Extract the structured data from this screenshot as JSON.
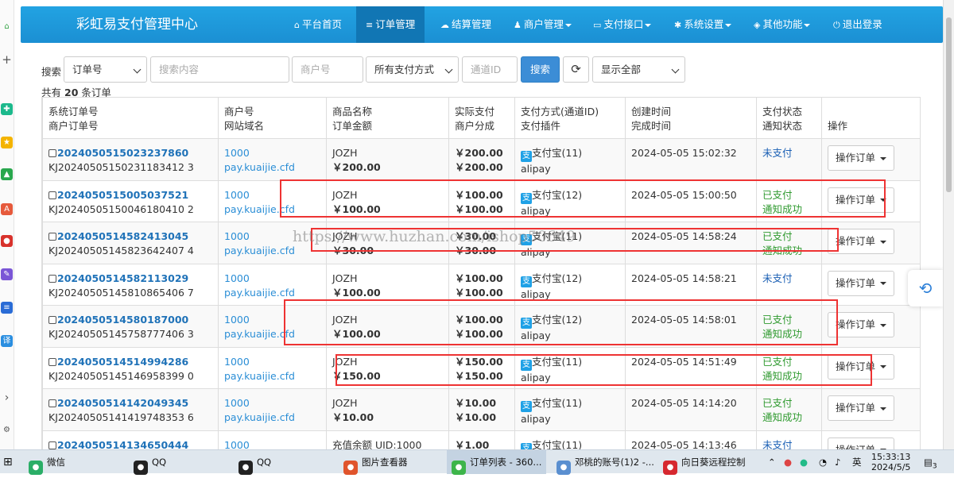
{
  "nav": {
    "brand": "彩虹易支付管理中心",
    "items": [
      {
        "icon": "home-icon",
        "glyph": "⌂",
        "label": "平台首页",
        "dropdown": false
      },
      {
        "icon": "list-icon",
        "glyph": "≡",
        "label": "订单管理",
        "dropdown": false,
        "active": true
      },
      {
        "icon": "cloud-icon",
        "glyph": "☁",
        "label": "结算管理",
        "dropdown": false
      },
      {
        "icon": "user-icon",
        "glyph": "♟",
        "label": "商户管理",
        "dropdown": true
      },
      {
        "icon": "card-icon",
        "glyph": "▭",
        "label": "支付接口",
        "dropdown": true
      },
      {
        "icon": "gear-icon",
        "glyph": "✱",
        "label": "系统设置",
        "dropdown": true
      },
      {
        "icon": "apps-icon",
        "glyph": "◈",
        "label": "其他功能",
        "dropdown": true
      },
      {
        "icon": "power-icon",
        "glyph": "⏻",
        "label": "退出登录",
        "dropdown": false
      }
    ]
  },
  "search": {
    "label": "搜索",
    "field_select": "订单号",
    "content_placeholder": "搜索内容",
    "merchant_placeholder": "商户号",
    "paytype_select": "所有支付方式",
    "channel_placeholder": "通道ID",
    "search_button": "搜索",
    "refresh_glyph": "⟳",
    "display_select": "显示全部"
  },
  "summary": {
    "prefix": "共有",
    "count": "20",
    "suffix": "条订单"
  },
  "table": {
    "headers": [
      [
        "系统订单号",
        "商户订单号"
      ],
      [
        "商户号",
        "网站域名"
      ],
      [
        "商品名称",
        "订单金额"
      ],
      [
        "实际支付",
        "商户分成"
      ],
      [
        "支付方式(通道ID)",
        "支付插件"
      ],
      [
        "创建时间",
        "完成时间"
      ],
      [
        "支付状态",
        "通知状态"
      ],
      [
        "操作",
        ""
      ]
    ],
    "rows": [
      {
        "trade_no": "2024050515023237860",
        "out_trade_no": "KJ20240505150231183412 3",
        "uid": "1000",
        "domain": "pay.kuaijie.cfd",
        "name": "JOZH",
        "money": "￥200.00",
        "realmoney": "￥200.00",
        "getmoney": "￥200.00",
        "type_icon": "支",
        "type": "支付宝(11)",
        "plugin": "alipay",
        "addtime": "2024-05-05 15:02:32",
        "endtime": "",
        "status": "未支付",
        "status_class": "st-unpaid",
        "notify": "",
        "op": "操作订单"
      },
      {
        "trade_no": "2024050515005037521",
        "out_trade_no": "KJ20240505150046180410 2",
        "uid": "1000",
        "domain": "pay.kuaijie.cfd",
        "name": "JOZH",
        "money": "￥100.00",
        "realmoney": "￥100.00",
        "getmoney": "￥100.00",
        "type_icon": "支",
        "type": "支付宝(12)",
        "plugin": "alipay",
        "addtime": "2024-05-05 15:00:50",
        "endtime": "",
        "status": "已支付",
        "status_class": "st-paid",
        "notify": "通知成功",
        "op": "操作订单"
      },
      {
        "trade_no": "2024050514582413045",
        "out_trade_no": "KJ20240505145823642407 4",
        "uid": "1000",
        "domain": "pay.kuaijie.cfd",
        "name": "JOZH",
        "money": "￥30.00",
        "realmoney": "￥30.00",
        "getmoney": "￥30.00",
        "type_icon": "支",
        "type": "支付宝(11)",
        "plugin": "alipay",
        "addtime": "2024-05-05 14:58:24",
        "endtime": "",
        "status": "已支付",
        "status_class": "st-paid",
        "notify": "通知成功",
        "op": "操作订单"
      },
      {
        "trade_no": "2024050514582113029",
        "out_trade_no": "KJ20240505145810865406 7",
        "uid": "1000",
        "domain": "pay.kuaijie.cfd",
        "name": "JOZH",
        "money": "￥100.00",
        "realmoney": "￥100.00",
        "getmoney": "￥100.00",
        "type_icon": "支",
        "type": "支付宝(12)",
        "plugin": "alipay",
        "addtime": "2024-05-05 14:58:21",
        "endtime": "",
        "status": "未支付",
        "status_class": "st-unpaid",
        "notify": "",
        "op": "操作订单"
      },
      {
        "trade_no": "2024050514580187000",
        "out_trade_no": "KJ20240505145758777406 3",
        "uid": "1000",
        "domain": "pay.kuaijie.cfd",
        "name": "JOZH",
        "money": "￥100.00",
        "realmoney": "￥100.00",
        "getmoney": "￥100.00",
        "type_icon": "支",
        "type": "支付宝(12)",
        "plugin": "alipay",
        "addtime": "2024-05-05 14:58:01",
        "endtime": "",
        "status": "已支付",
        "status_class": "st-paid",
        "notify": "通知成功",
        "op": "操作订单"
      },
      {
        "trade_no": "2024050514514994286",
        "out_trade_no": "KJ20240505145146958399 0",
        "uid": "1000",
        "domain": "pay.kuaijie.cfd",
        "name": "JOZH",
        "money": "￥150.00",
        "realmoney": "￥150.00",
        "getmoney": "￥150.00",
        "type_icon": "支",
        "type": "支付宝(11)",
        "plugin": "alipay",
        "addtime": "2024-05-05 14:51:49",
        "endtime": "",
        "status": "已支付",
        "status_class": "st-paid",
        "notify": "通知成功",
        "op": "操作订单"
      },
      {
        "trade_no": "2024050514142049345",
        "out_trade_no": "KJ20240505141419748353 6",
        "uid": "1000",
        "domain": "pay.kuaijie.cfd",
        "name": "JOZH",
        "money": "￥10.00",
        "realmoney": "￥10.00",
        "getmoney": "￥10.00",
        "type_icon": "支",
        "type": "支付宝(11)",
        "plugin": "alipay",
        "addtime": "2024-05-05 14:14:20",
        "endtime": "",
        "status": "已支付",
        "status_class": "st-paid",
        "notify": "通知成功",
        "op": "操作订单"
      },
      {
        "trade_no": "2024050514134650444",
        "out_trade_no": "",
        "uid": "1000",
        "domain": "",
        "name": "充值余额 UID:1000",
        "money": "",
        "realmoney": "￥1.00",
        "getmoney": "",
        "type_icon": "支",
        "type": "支付宝(11)",
        "plugin": "",
        "addtime": "2024-05-05 14:13:46",
        "endtime": "",
        "status": "未支付",
        "status_class": "st-unpaid",
        "notify": "",
        "op": "操作订单"
      }
    ]
  },
  "watermark": "https://www.huzhan.com/ishop50649",
  "taskbar": {
    "items": [
      {
        "name": "wechat",
        "icon": "wechat-icon",
        "label": "微信",
        "color": "#2aae67"
      },
      {
        "name": "qq-1",
        "icon": "qq-icon",
        "label": "QQ",
        "color": "#222"
      },
      {
        "name": "qq-2",
        "icon": "qq-icon",
        "label": "QQ",
        "color": "#222"
      },
      {
        "name": "image-viewer",
        "icon": "image-icon",
        "label": "图片查看器",
        "color": "#e0542c"
      },
      {
        "name": "browser-360",
        "icon": "browser-icon",
        "label": "订单列表 - 360...",
        "color": "#3db54a"
      },
      {
        "name": "notepad",
        "icon": "document-icon",
        "label": "邓桃的账号(1)2 -...",
        "color": "#5a8fd0"
      },
      {
        "name": "sunflower",
        "icon": "remote-icon",
        "label": "向日葵远程控制",
        "color": "#d6282f"
      }
    ],
    "tray_text": "英",
    "time": "15:33:13",
    "date": "2024/5/5",
    "notification_count": "3"
  }
}
